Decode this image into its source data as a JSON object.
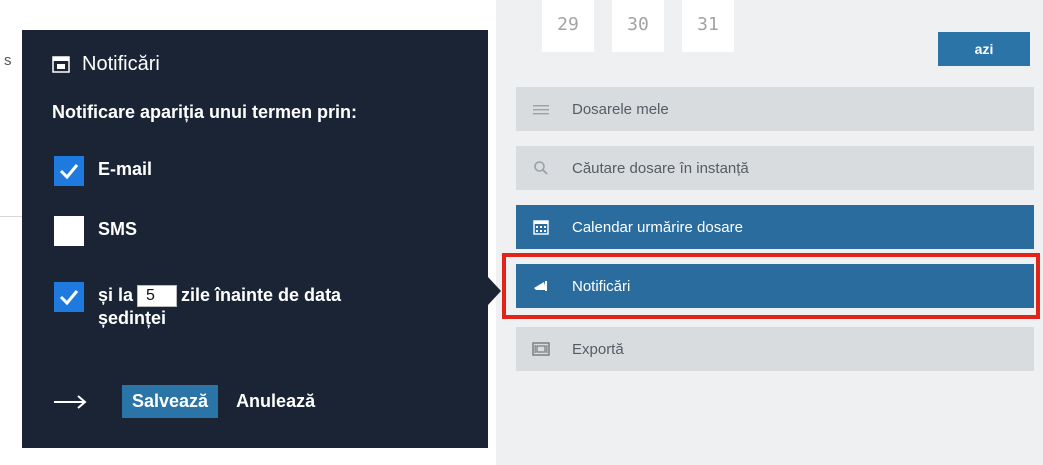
{
  "background": {
    "edge_letter": "s"
  },
  "popup": {
    "title": "Notificări",
    "subtitle": "Notificare apariția unui termen prin:",
    "options": {
      "email": {
        "label": "E-mail",
        "checked": true
      },
      "sms": {
        "label": "SMS",
        "checked": false
      },
      "days": {
        "prefix": "și la",
        "value": "5",
        "suffix_line1": "zile înainte de data",
        "suffix_line2": "ședinței",
        "checked": true
      }
    },
    "save_label": "Salvează",
    "cancel_label": "Anulează"
  },
  "calendar": {
    "dates": [
      "29",
      "30",
      "31"
    ],
    "today_label": "azi"
  },
  "menu": {
    "items": [
      {
        "label": "Dosarele mele",
        "icon": "list-icon",
        "style": "light"
      },
      {
        "label": "Căutare dosare în instanță",
        "icon": "search-icon",
        "style": "light"
      },
      {
        "label": "Calendar urmărire dosare",
        "icon": "calendar-icon",
        "style": "dark"
      },
      {
        "label": "Notificări",
        "icon": "megaphone-icon",
        "style": "dark",
        "highlighted": true
      },
      {
        "label": "Exportă",
        "icon": "export-icon",
        "style": "light"
      }
    ]
  },
  "colors": {
    "popup_bg": "#1a2435",
    "accent_blue": "#2a74a8",
    "checkbox_checked": "#1f7ae0",
    "highlight_red": "#e2231a",
    "sidebar_bg": "#eef0f2"
  }
}
